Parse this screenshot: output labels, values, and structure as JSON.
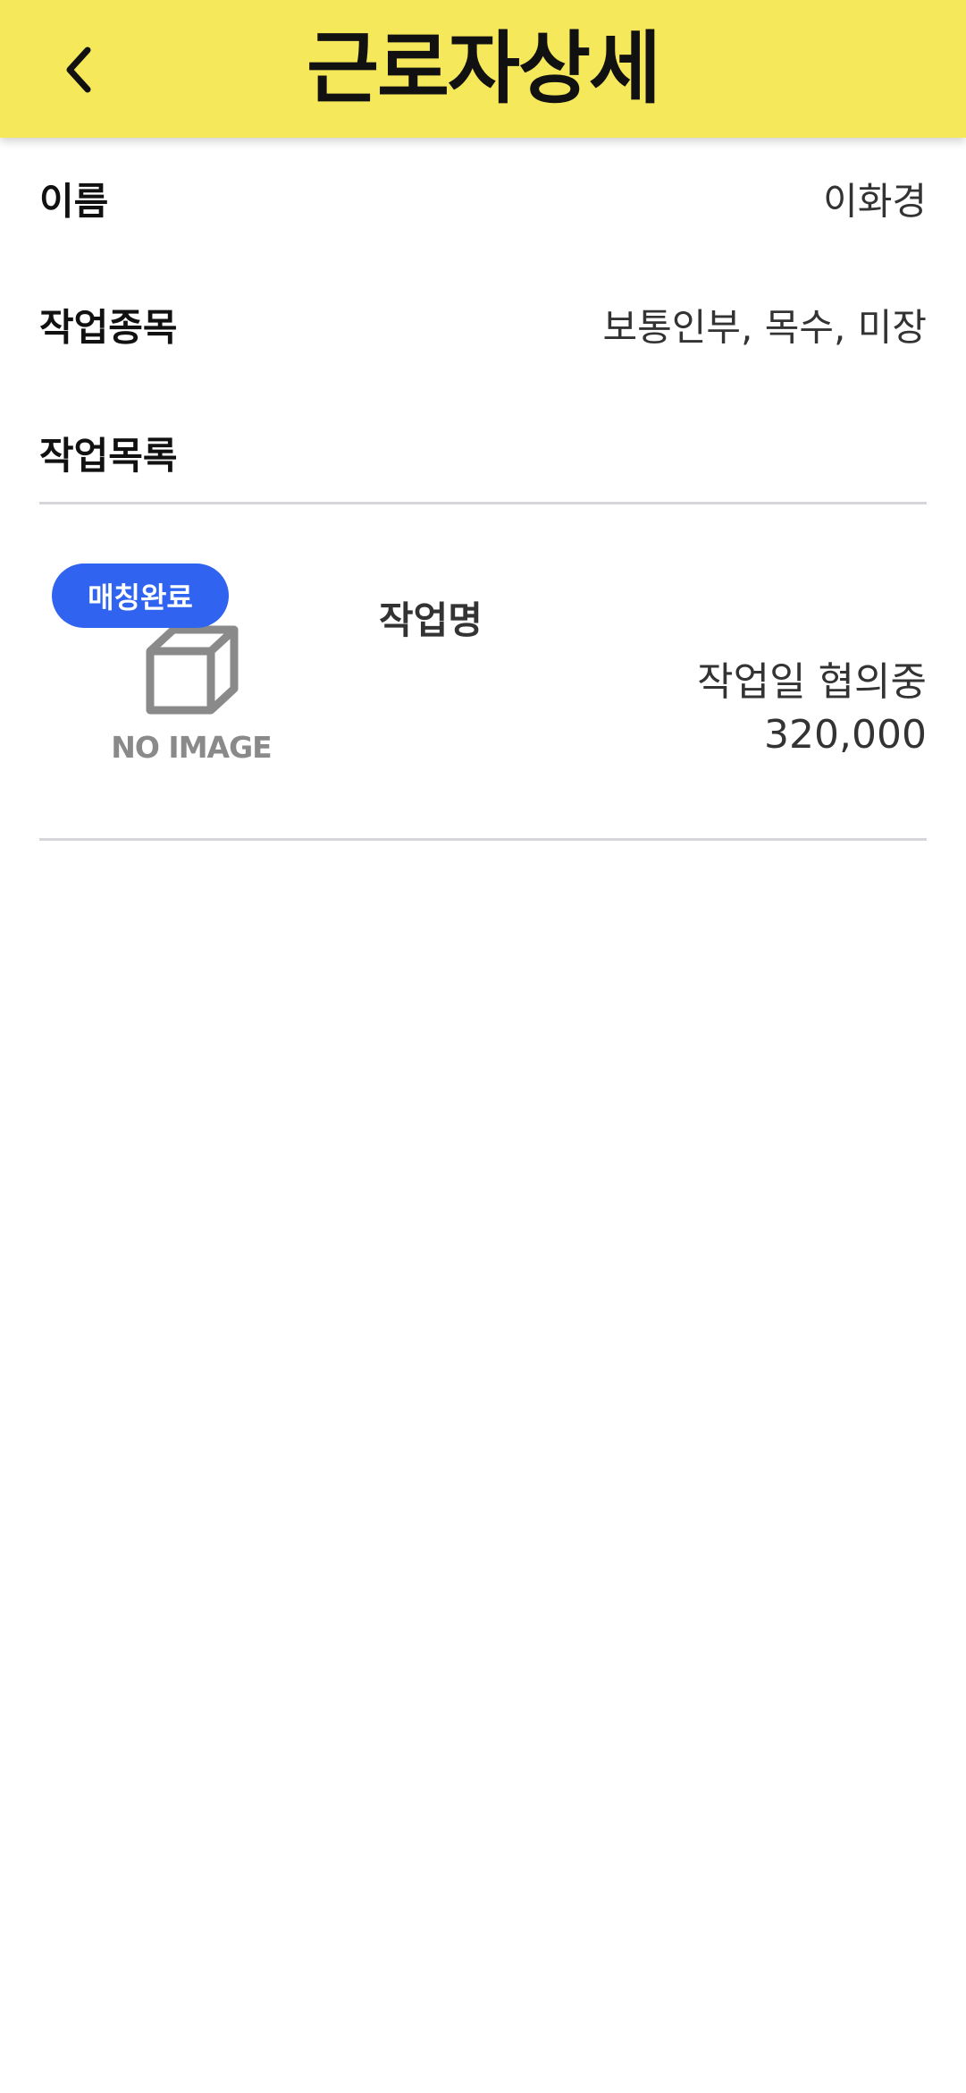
{
  "header": {
    "title": "근로자상세",
    "back_icon": "chevron-left-icon",
    "background_color": "#f5e85a"
  },
  "worker": {
    "name_label": "이름",
    "name_value": "이화경",
    "work_type_label": "작업종목",
    "work_type_value": "보통인부, 목수, 미장"
  },
  "job_list": {
    "title": "작업목록",
    "items": [
      {
        "status_badge": "매칭완료",
        "status_color": "#2f63f0",
        "thumbnail_text": "NO IMAGE",
        "thumbnail_icon": "box-icon",
        "name": "작업명",
        "date": "작업일 협의중",
        "price": "320,000"
      }
    ]
  }
}
